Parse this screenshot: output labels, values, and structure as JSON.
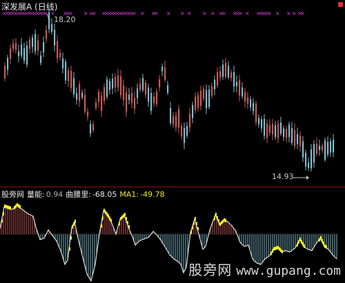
{
  "window": {
    "title": "深发展A (日线)",
    "high_label": "18.20",
    "low_label": "14.93"
  },
  "indicator": {
    "name": "股旁网",
    "energy_label": "量能:",
    "energy_value": "0.94",
    "curve_label": "曲腰里:",
    "curve_value": "-68.05",
    "ma_label": "MA1:",
    "ma_value": "-49.78"
  },
  "watermark": {
    "cn": "股旁网",
    "url": "www.gupang.com"
  },
  "colors": {
    "up": "#c85a5a",
    "down": "#7fbccc",
    "marker_pink": "#e040e0",
    "signal_yellow": "#f0f020",
    "divider": "#9a1010"
  }
}
